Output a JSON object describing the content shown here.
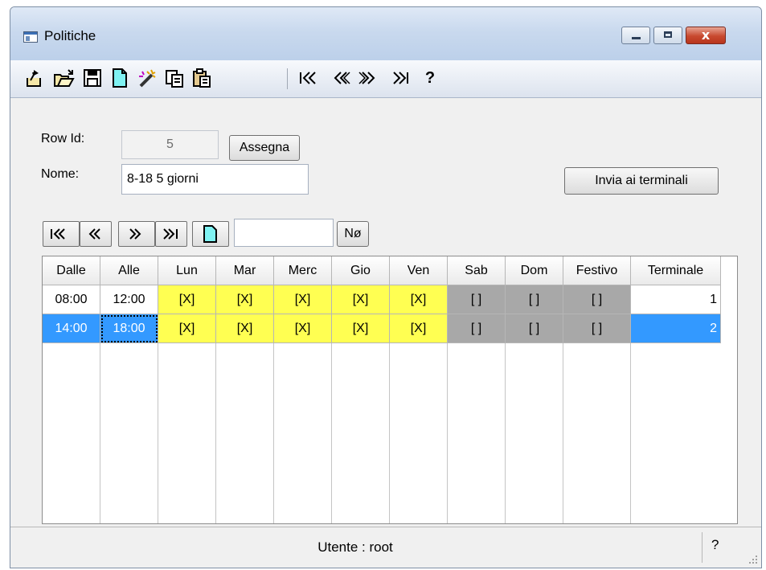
{
  "window": {
    "title": "Politiche"
  },
  "titlebar": {
    "close_glyph": "x"
  },
  "toolbar": {
    "icons": [
      "export-icon",
      "open-folder-icon",
      "save-icon",
      "new-document-icon",
      "magic-wand-icon",
      "copy-icon",
      "paste-icon",
      "first-record-icon",
      "previous-record-icon",
      "next-record-icon",
      "last-record-icon",
      "help-icon"
    ],
    "help_label": "?"
  },
  "form": {
    "row_id_label": "Row Id:",
    "row_id_value": "5",
    "assign_label": "Assegna",
    "name_label": "Nome:",
    "name_value": "8-18 5 giorni",
    "send_label": "Invia ai terminali"
  },
  "nav": {
    "new_label": "Nø",
    "search_value": ""
  },
  "grid": {
    "columns": [
      "Dalle",
      "Alle",
      "Lun",
      "Mar",
      "Merc",
      "Gio",
      "Ven",
      "Sab",
      "Dom",
      "Festivo",
      "Terminale"
    ],
    "rows": [
      {
        "cells": [
          "08:00",
          "12:00",
          "[X]",
          "[X]",
          "[X]",
          "[X]",
          "[X]",
          "[ ]",
          "[ ]",
          "[ ]",
          "1"
        ],
        "selected": false
      },
      {
        "cells": [
          "14:00",
          "18:00",
          "[X]",
          "[X]",
          "[X]",
          "[X]",
          "[X]",
          "[ ]",
          "[ ]",
          "[ ]",
          "2"
        ],
        "selected": true
      }
    ],
    "colors": {
      "checked": "#ffff52",
      "unchecked": "#a8a8a8",
      "selection": "#3399ff"
    }
  },
  "status": {
    "user": "Utente : root",
    "help": "?"
  }
}
